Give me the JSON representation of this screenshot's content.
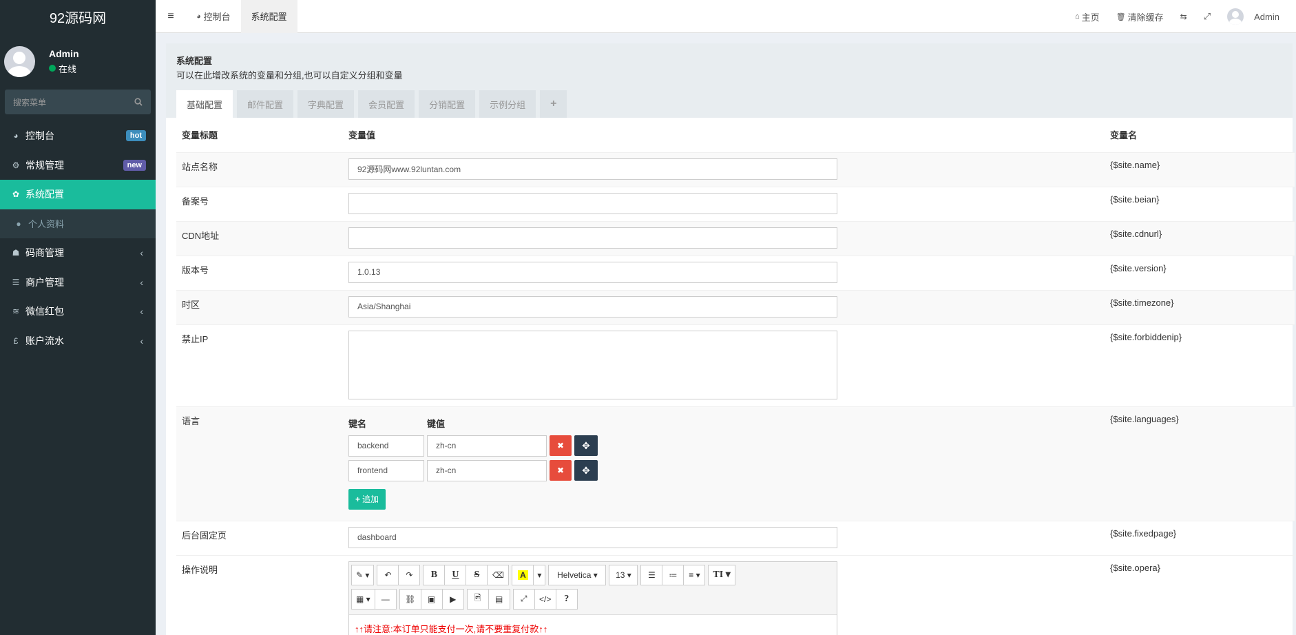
{
  "sidebar": {
    "logo": "92源码网",
    "user_name": "Admin",
    "user_status": "在线",
    "search_placeholder": "搜索菜单",
    "items": [
      {
        "label": "控制台",
        "icon": "dashboard-icon",
        "badge": "hot"
      },
      {
        "label": "常规管理",
        "icon": "cogs-icon",
        "badge": "new"
      },
      {
        "label": "系统配置",
        "icon": "gear-icon",
        "active": true
      },
      {
        "label": "个人资料",
        "icon": "user-icon"
      },
      {
        "label": "码商管理",
        "icon": "users-icon"
      },
      {
        "label": "商户管理",
        "icon": "list-icon"
      },
      {
        "label": "微信红包",
        "icon": "database-icon"
      },
      {
        "label": "账户流水",
        "icon": "pound-icon"
      }
    ]
  },
  "topbar": {
    "tabs": [
      {
        "label": "控制台"
      },
      {
        "label": "系统配置"
      }
    ],
    "home": "主页",
    "clear_cache": "清除缓存",
    "user": "Admin"
  },
  "panel": {
    "title": "系统配置",
    "description": "可以在此增改系统的变量和分组,也可以自定义分组和变量",
    "tabs": [
      "基础配置",
      "邮件配置",
      "字典配置",
      "会员配置",
      "分销配置",
      "示例分组",
      "+"
    ]
  },
  "table": {
    "headers": [
      "变量标题",
      "变量值",
      "变量名"
    ],
    "rows": [
      {
        "title": "站点名称",
        "value": "92源码网www.92luntan.com",
        "name": "{$site.name}"
      },
      {
        "title": "备案号",
        "value": "",
        "name": "{$site.beian}"
      },
      {
        "title": "CDN地址",
        "value": "",
        "name": "{$site.cdnurl}"
      },
      {
        "title": "版本号",
        "value": "1.0.13",
        "name": "{$site.version}"
      },
      {
        "title": "时区",
        "value": "Asia/Shanghai",
        "name": "{$site.timezone}"
      },
      {
        "title": "禁止IP",
        "value": "",
        "name": "{$site.forbiddenip}"
      },
      {
        "title": "语言",
        "name": "{$site.languages}"
      },
      {
        "title": "后台固定页",
        "value": "dashboard",
        "name": "{$site.fixedpage}"
      },
      {
        "title": "操作说明",
        "name": "{$site.opera}"
      }
    ],
    "languages": {
      "key_header": "键名",
      "value_header": "键值",
      "items": [
        {
          "key": "backend",
          "value": "zh-cn"
        },
        {
          "key": "frontend",
          "value": "zh-cn"
        }
      ],
      "add_label": "追加"
    }
  },
  "editor": {
    "font_name": "Helvetica",
    "font_size": "13",
    "content_line1": "↑↑请注意:本订单只能支付一次,请不要重复付款↑↑"
  },
  "colors": {
    "sidebar_bg": "#222d32",
    "accent": "#1abc9c",
    "danger": "#e74c3c",
    "dark": "#2c3e50"
  }
}
